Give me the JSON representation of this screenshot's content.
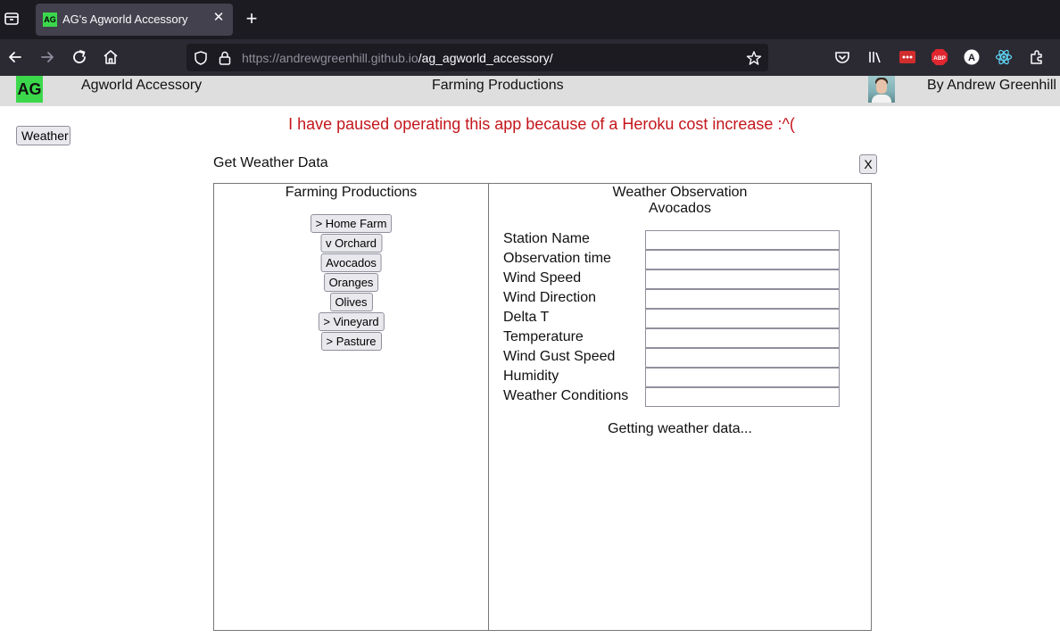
{
  "browser": {
    "tab_title": "AG's Agworld Accessory",
    "tab_favicon_text": "AG",
    "url_host": "https://andrewgreenhill.github.io",
    "url_path": "/ag_agworld_accessory/",
    "toolbar_icons": [
      "tab-list-icon",
      "back-icon",
      "forward-icon",
      "reload-icon",
      "home-icon",
      "shield-icon",
      "lock-icon",
      "star-icon",
      "pocket-icon",
      "library-icon",
      "lastpass-icon",
      "adblock-plus-icon",
      "account-icon",
      "react-devtools-icon",
      "extensions-icon"
    ],
    "abp_label": "ABP",
    "account_label": "A"
  },
  "header": {
    "logo": "AG",
    "app_title": "Agworld Accessory",
    "farm_title": "Farming Productions",
    "author": "By Andrew Greenhill",
    "logo_color": "#3cd84c"
  },
  "notice": "I have paused operating this app because of a Heroku cost increase :^(",
  "weather_button": "Weather",
  "dialog": {
    "title": "Get Weather Data",
    "close_label": "X",
    "left_panel": {
      "heading": "Farming Productions",
      "items": [
        "> Home Farm",
        "v Orchard",
        "Avocados",
        "Oranges",
        "Olives",
        "> Vineyard",
        "> Pasture"
      ]
    },
    "right_panel": {
      "heading_line1": "Weather Observation",
      "heading_line2": "Avocados",
      "fields": [
        {
          "label": "Station Name",
          "value": ""
        },
        {
          "label": "Observation time",
          "value": ""
        },
        {
          "label": "Wind Speed",
          "value": ""
        },
        {
          "label": "Wind Direction",
          "value": ""
        },
        {
          "label": "Delta T",
          "value": ""
        },
        {
          "label": "Temperature",
          "value": ""
        },
        {
          "label": "Wind Gust Speed",
          "value": ""
        },
        {
          "label": "Humidity",
          "value": ""
        },
        {
          "label": "Weather Conditions",
          "value": ""
        }
      ],
      "status": "Getting weather data..."
    }
  },
  "colors": {
    "notice": "#c4161c",
    "header_bg": "#dedede",
    "browser_bg": "#1c1b22"
  }
}
